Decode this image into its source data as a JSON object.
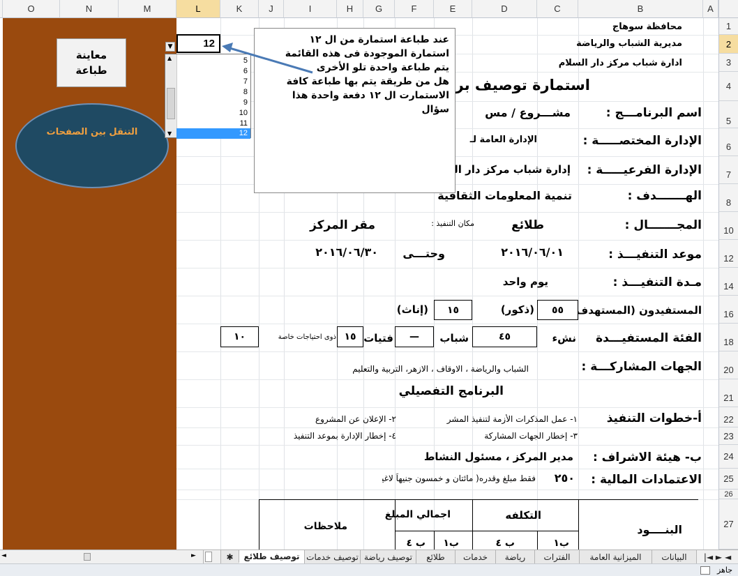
{
  "columns": [
    "O",
    "N",
    "M",
    "L",
    "K",
    "J",
    "I",
    "H",
    "G",
    "F",
    "E",
    "D",
    "C",
    "B",
    "A"
  ],
  "rows": [
    "1",
    "2",
    "3",
    "4",
    "5",
    "6",
    "7",
    "8",
    "10",
    "12",
    "14",
    "16",
    "18",
    "20",
    "21",
    "22",
    "23",
    "24",
    "25",
    "26",
    "27"
  ],
  "name_box_value": "12",
  "preview_button": "معاينة طباعة",
  "navigate_shape": "التنقل بين الصفحات",
  "listbox_items": [
    "5",
    "6",
    "7",
    "8",
    "9",
    "10",
    "11",
    "12"
  ],
  "callout_lines": [
    "عند طباعة استمارة من ال ١٢",
    "استمارة الموجودة فى هذه القائمة",
    "يتم طباعة واحدة تلو الأخرى",
    "هل من طريقة يتم بها طباعة كافة",
    "الاستمارت ال ١٢ دفعة واحدة هذا",
    "سؤال"
  ],
  "header": {
    "gov": "محافظة سوهاج",
    "dir": "مديرية الشباب والرياضة",
    "admin": "ادارة شباب مركز دار السلام",
    "title": "استمارة توصيف برنا"
  },
  "form": {
    "program_label": "اسم البرنامـــج :",
    "program_value": "مشـــروع / مس",
    "dept_label": "الإدارة المختصـــــة :",
    "dept_value": "الإدارة العامة لـ",
    "sub_label": "الإدارة الفرعيـــــة :",
    "sub_value": "إدارة شباب مركز دار الس",
    "goal_label": "الهـــــــدف :",
    "goal_value": "تنمية المعلومات الثقافية",
    "field_label": "المجـــــــال :",
    "field_value": "طلائع",
    "place_label": "مكان التنفيذ :",
    "place_value": "مقر المركز",
    "date_label": "موعد التنفيـــذ :",
    "date_from": "٢٠١٦/٠٦/٠١",
    "date_to_label": "وحتـــى",
    "date_to": "٢٠١٦/٠٦/٣٠",
    "duration_label": "مـدة التنفيـــذ :",
    "duration_value": "يوم واحد",
    "benef_label": "المستفيدون (المستهدف)",
    "males_value": "٥٥",
    "males_label": "(ذكور)",
    "females_value": "١٥",
    "females_label": "(إناث)",
    "cat_label": "الفئة المستفيـــدة",
    "cat_youth_lbl": "نشء",
    "cat_youth_val": "٤٥",
    "cat_young_lbl": "شباب",
    "cat_young_val": "—",
    "cat_girls_lbl": "فتيات",
    "cat_girls_val": "١٥",
    "cat_special_lbl": "ذوى احتياجات خاصة",
    "cat_special_val": "١٠",
    "partners_label": "الجهات المشاركـــة :",
    "partners_value": "الشباب والرياضة ، الاوقاف ، الازهر، التربية والتعليم",
    "detail_title": "البرنامج التفصيلي",
    "steps_label": "أ-خطوات التنفيذ",
    "step1": "١- عمل المذكرات الأزمة لتنفيذ المشر",
    "step2": "٢- الإعلان عن المشروع",
    "step3": "٣- إخطار الجهات المشاركة",
    "step4": "٤- إخطار الإدارة بموعد التنفيذ",
    "super_label": "ب- هيئة الاشراف :",
    "super_value": "مدير المركز ، مسئول النشاط",
    "budget_label": "الاعتمادات المالية :",
    "budget_value": "٢٥٠",
    "budget_text": "فقط مبلغ وقدره( مائتان و خمسون جنيهاً لاغير",
    "tbl_items": "البنــــود",
    "tbl_cost": "التكلفه",
    "tbl_total": "اجمالي المبلغ",
    "tbl_notes": "ملاحظات",
    "tbl_b1": "ب١",
    "tbl_b4": "ب ٤"
  },
  "sheet_tabs": [
    "البيانات",
    "الميزانية العامة",
    "الفترات",
    "رياضة",
    "خدمات",
    "طلائع",
    "توصيف رياضة",
    "توصيف خدمات",
    "توصيف طلائع"
  ],
  "active_tab": "توصيف طلائع",
  "status_text": "جاهز"
}
